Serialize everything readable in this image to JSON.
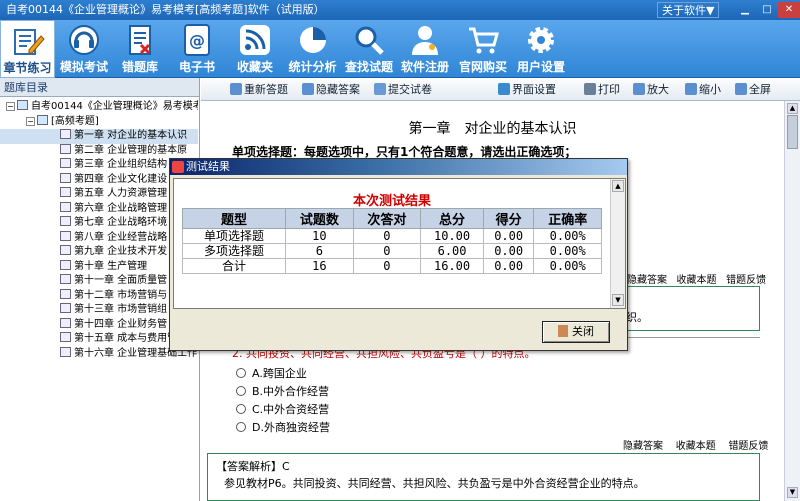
{
  "window": {
    "title": "自考00144《企业管理概论》易考模考[高频考题]软件（试用版）",
    "about_label": "关于软件▼"
  },
  "toolbar": [
    {
      "label": "章节练习",
      "icon": "edit-icon",
      "active": true
    },
    {
      "label": "模拟考试",
      "icon": "headset-icon",
      "active": false
    },
    {
      "label": "错题库",
      "icon": "wrong-book-icon",
      "active": false
    },
    {
      "label": "电子书",
      "icon": "ebook-icon",
      "active": false
    },
    {
      "label": "收藏夹",
      "icon": "rss-icon",
      "active": false
    },
    {
      "label": "统计分析",
      "icon": "pie-chart-icon",
      "active": false
    },
    {
      "label": "查找试题",
      "icon": "search-icon",
      "active": false
    },
    {
      "label": "软件注册",
      "icon": "key-user-icon",
      "active": false
    },
    {
      "label": "官网购买",
      "icon": "cart-icon",
      "active": false
    },
    {
      "label": "用户设置",
      "icon": "gear-icon",
      "active": false
    }
  ],
  "sidebar": {
    "header": "题库目录",
    "root": "自考00144《企业管理概论》易考模考软",
    "group": "[高频考题]",
    "chapters": [
      "第一章 对企业的基本认识",
      "第二章 企业管理的基本原",
      "第三章 企业组织结构",
      "第四章 企业文化建设",
      "第五章 人力资源管理",
      "第六章 企业战略管理",
      "第七章 企业战略环境",
      "第八章 企业经营战略",
      "第九章 企业技术开发",
      "第十章 生产管理",
      "第十一章 全面质量管",
      "第十二章 市场营销与",
      "第十三章 市场营销组",
      "第十四章 企业财务管",
      "第十五章 成本与费用管理",
      "第十六章 企业管理基础工作"
    ]
  },
  "content_toolbar": {
    "restart": "重新答题",
    "hide_answers": "隐藏答案",
    "submit": "提交试卷",
    "interface": "界面设置",
    "print": "打印",
    "zoom_in": "放大",
    "zoom_out": "缩小",
    "fullscreen": "全屏"
  },
  "content": {
    "chapter_title": "第一章　对企业的基本认识",
    "section_desc": "单项选择题：每题选项中，只有1个符合题意，请选出正确选项；",
    "actions": {
      "hide_answer": "隐藏答案",
      "favorite": "收藏本题",
      "report": "错题反馈"
    },
    "q1_tail": "织。",
    "q2_text": "2. 共同投资、共同经营、共担风险、共负盈亏是（ ）的特点。",
    "options": [
      "A.跨国企业",
      "B.中外合作经营",
      "C.中外合资经营",
      "D.外商独资经营"
    ],
    "analysis_title": "【答案解析】C",
    "analysis_text": "参见教材P6。共同投资、共同经营、共担风险、共负盈亏是中外合资经营企业的特点。"
  },
  "dialog": {
    "title": "测试结果",
    "heading": "本次测试结果",
    "columns": [
      "题型",
      "试题数",
      "次答对",
      "总分",
      "得分",
      "正确率"
    ],
    "rows": [
      [
        "单项选择题",
        "10",
        "0",
        "10.00",
        "0.00",
        "0.00%"
      ],
      [
        "多项选择题",
        "6",
        "0",
        "6.00",
        "0.00",
        "0.00%"
      ],
      [
        "合计",
        "16",
        "0",
        "16.00",
        "0.00",
        "0.00%"
      ]
    ],
    "close_label": "关闭"
  }
}
